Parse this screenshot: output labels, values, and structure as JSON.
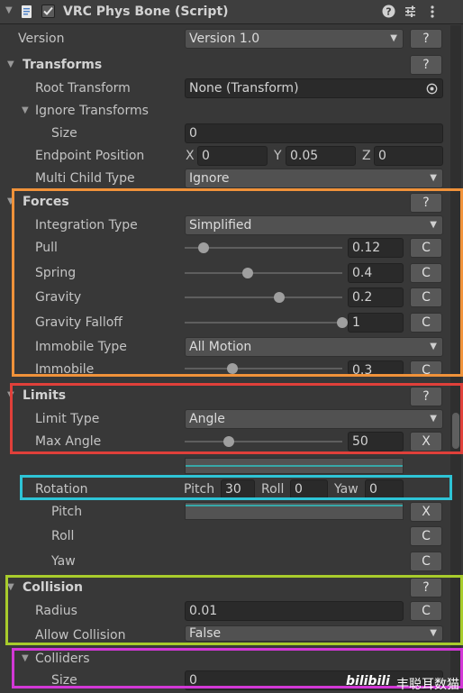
{
  "header": {
    "title": "VRC Phys Bone (Script)",
    "enabled": true,
    "help_icon": "help-icon",
    "preset_icon": "sliders-icon",
    "menu_icon": "kebab-menu-icon"
  },
  "version": {
    "label": "Version",
    "value": "Version 1.0",
    "help": "?"
  },
  "transforms": {
    "title": "Transforms",
    "help": "?",
    "root_transform": {
      "label": "Root Transform",
      "value": "None (Transform)"
    },
    "ignore_transforms": {
      "label": "Ignore Transforms",
      "size_label": "Size",
      "size_value": "0"
    },
    "endpoint_position": {
      "label": "Endpoint Position",
      "x_label": "X",
      "x": "0",
      "y_label": "Y",
      "y": "0.05",
      "z_label": "Z",
      "z": "0"
    },
    "multi_child_type": {
      "label": "Multi Child Type",
      "value": "Ignore"
    }
  },
  "forces": {
    "title": "Forces",
    "help": "?",
    "integration_type": {
      "label": "Integration Type",
      "value": "Simplified"
    },
    "pull": {
      "label": "Pull",
      "value": "0.12",
      "level": 0.12,
      "curve_button": "C"
    },
    "spring": {
      "label": "Spring",
      "value": "0.4",
      "level": 0.4,
      "curve_button": "C"
    },
    "gravity": {
      "label": "Gravity",
      "value": "0.2",
      "level": 0.6,
      "curve_button": "C"
    },
    "gravity_falloff": {
      "label": "Gravity Falloff",
      "value": "1",
      "level": 1.0,
      "curve_button": "C"
    },
    "immobile_type": {
      "label": "Immobile Type",
      "value": "All Motion"
    },
    "immobile": {
      "label": "Immobile",
      "value": "0.3",
      "level": 0.3,
      "curve_button": "C"
    }
  },
  "limits": {
    "title": "Limits",
    "help": "?",
    "limit_type": {
      "label": "Limit Type",
      "value": "Angle"
    },
    "max_angle": {
      "label": "Max Angle",
      "value": "50",
      "level": 0.28,
      "curve_button": "X"
    },
    "rotation": {
      "label": "Rotation",
      "pitch_label": "Pitch",
      "pitch": "30",
      "roll_label": "Roll",
      "roll": "0",
      "yaw_label": "Yaw",
      "yaw": "0"
    },
    "pitch": {
      "label": "Pitch",
      "button": "X"
    },
    "roll": {
      "label": "Roll",
      "button": "C"
    },
    "yaw": {
      "label": "Yaw",
      "button": "C"
    }
  },
  "collision": {
    "title": "Collision",
    "help": "?",
    "radius": {
      "label": "Radius",
      "value": "0.01",
      "curve_button": "C"
    },
    "allow_collision": {
      "label": "Allow Collision",
      "value": "False"
    },
    "colliders": {
      "label": "Colliders",
      "size_label": "Size",
      "size_value": "0"
    }
  },
  "watermark": {
    "logo": "bilibili",
    "text": "丰聪耳数猫"
  },
  "colors": {
    "forces_box": "#f0923a",
    "limits_box": "#e0403a",
    "rotation_box": "#2ec4d6",
    "collision_box": "#a8cc2c",
    "colliders_box": "#d238d6",
    "curve_line": "#37a8a8"
  }
}
